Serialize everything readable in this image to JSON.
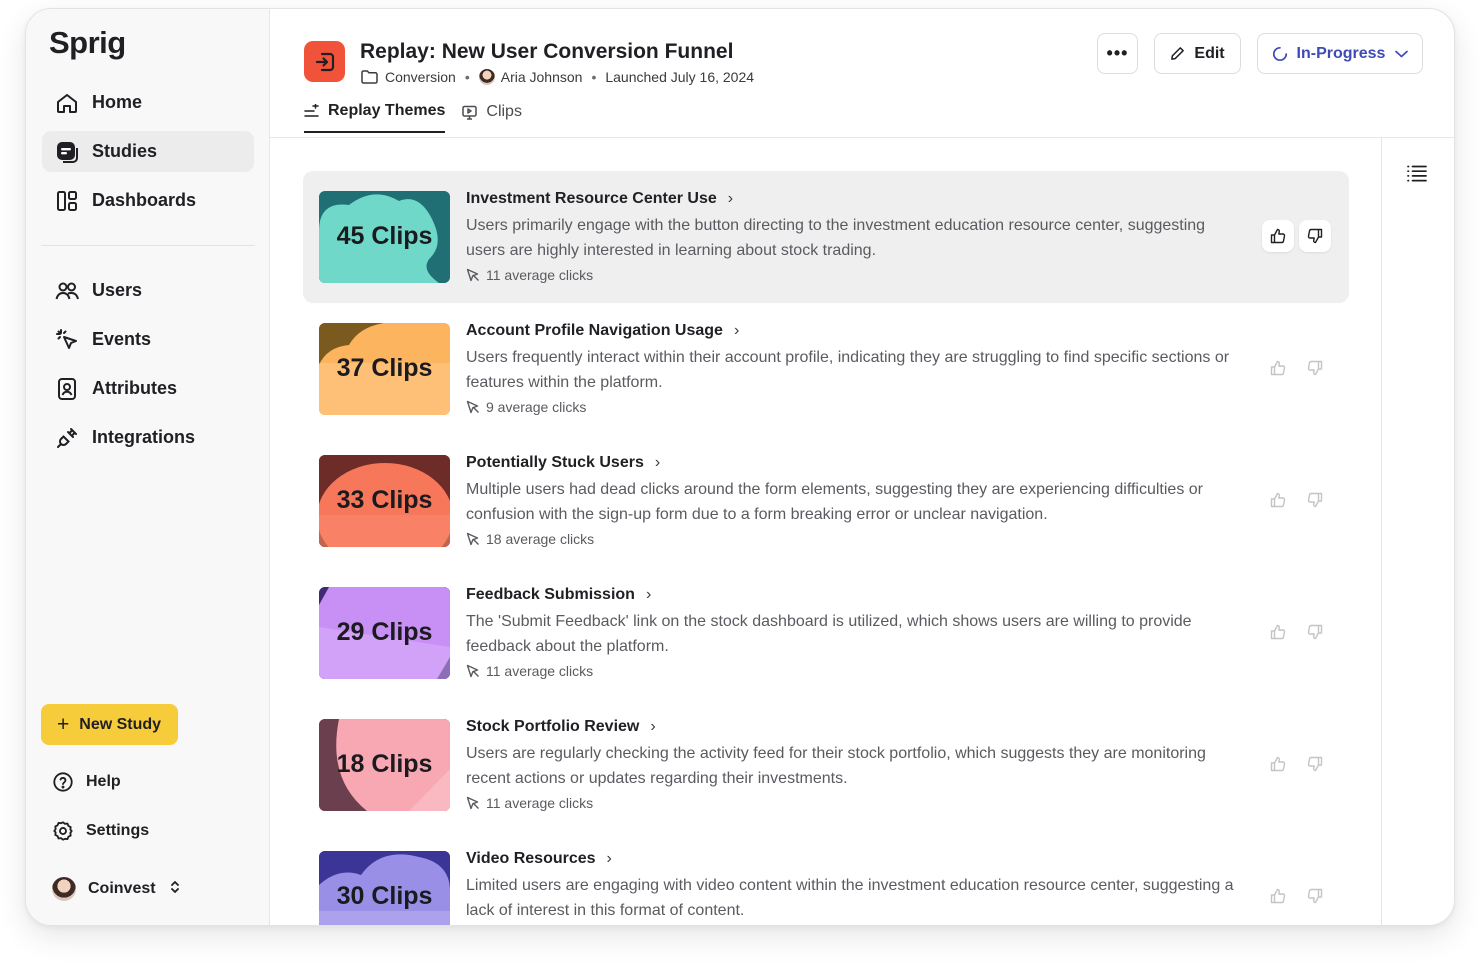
{
  "app": {
    "logo": "Sprig"
  },
  "sidebar": {
    "nav": [
      {
        "label": "Home",
        "icon": "home-icon"
      },
      {
        "label": "Studies",
        "icon": "studies-icon",
        "active": true
      },
      {
        "label": "Dashboards",
        "icon": "dashboards-icon"
      },
      {
        "label": "Users",
        "icon": "users-icon"
      },
      {
        "label": "Events",
        "icon": "events-icon"
      },
      {
        "label": "Attributes",
        "icon": "attributes-icon"
      },
      {
        "label": "Integrations",
        "icon": "integrations-icon"
      }
    ],
    "new_study": "New Study",
    "help": "Help",
    "settings": "Settings",
    "workspace": "Coinvest"
  },
  "header": {
    "title": "Replay: New User Conversion Funnel",
    "folder": "Conversion",
    "owner": "Aria Johnson",
    "launched": "Launched July 16, 2024",
    "more_label": "•••",
    "edit_label": "Edit",
    "status_label": "In-Progress",
    "status_color": "#3e4bb5"
  },
  "tabs": [
    {
      "label": "Replay Themes",
      "active": true
    },
    {
      "label": "Clips",
      "active": false
    }
  ],
  "themes": [
    {
      "clips": "45 Clips",
      "title": "Investment Resource Center Use",
      "desc": "Users primarily engage with the button directing to the investment education resource center, suggesting users are highly interested in learning about stock trading.",
      "clicks": "11 average clicks",
      "bg": "#6fd8c8",
      "bg2": "#a8ebe0",
      "accent": "#1f6f74"
    },
    {
      "clips": "37 Clips",
      "title": "Account Profile Navigation Usage",
      "desc": "Users frequently interact within their account profile, indicating they are struggling to find specific sections or features within the platform.",
      "clicks": "9 average clicks",
      "bg": "#fbb05a",
      "bg2": "#ffd49a",
      "accent": "#7a5a1e"
    },
    {
      "clips": "33 Clips",
      "title": "Potentially Stuck Users",
      "desc": "Multiple users had dead clicks around the form elements, suggesting they are experiencing difficulties or confusion with the sign-up form due to a form breaking error or unclear navigation.",
      "clicks": "18 average clicks",
      "bg": "#f7775a",
      "bg2": "#ffa08a",
      "accent": "#6e2c28"
    },
    {
      "clips": "29 Clips",
      "title": "Feedback Submission",
      "desc": "The 'Submit Feedback' link on the stock dashboard is utilized, which shows users are willing to provide feedback about the platform.",
      "clicks": "11 average clicks",
      "bg": "#c38ef2",
      "bg2": "#ddb9fb",
      "accent": "#3f2a73"
    },
    {
      "clips": "18 Clips",
      "title": "Stock Portfolio Review",
      "desc": "Users are regularly checking the activity feed for their stock portfolio, which suggests they are monitoring recent actions or updates regarding their investments.",
      "clicks": "11 average clicks",
      "bg": "#f7a8b2",
      "bg2": "#fccad0",
      "accent": "#6b3f4e"
    },
    {
      "clips": "30 Clips",
      "title": "Video Resources",
      "desc": "Limited users are engaging with video content within the investment education resource center, suggesting a lack of interest in this format of content.",
      "clicks": "",
      "bg": "#8f84e0",
      "bg2": "#b9b1f2",
      "accent": "#3a3597"
    }
  ]
}
